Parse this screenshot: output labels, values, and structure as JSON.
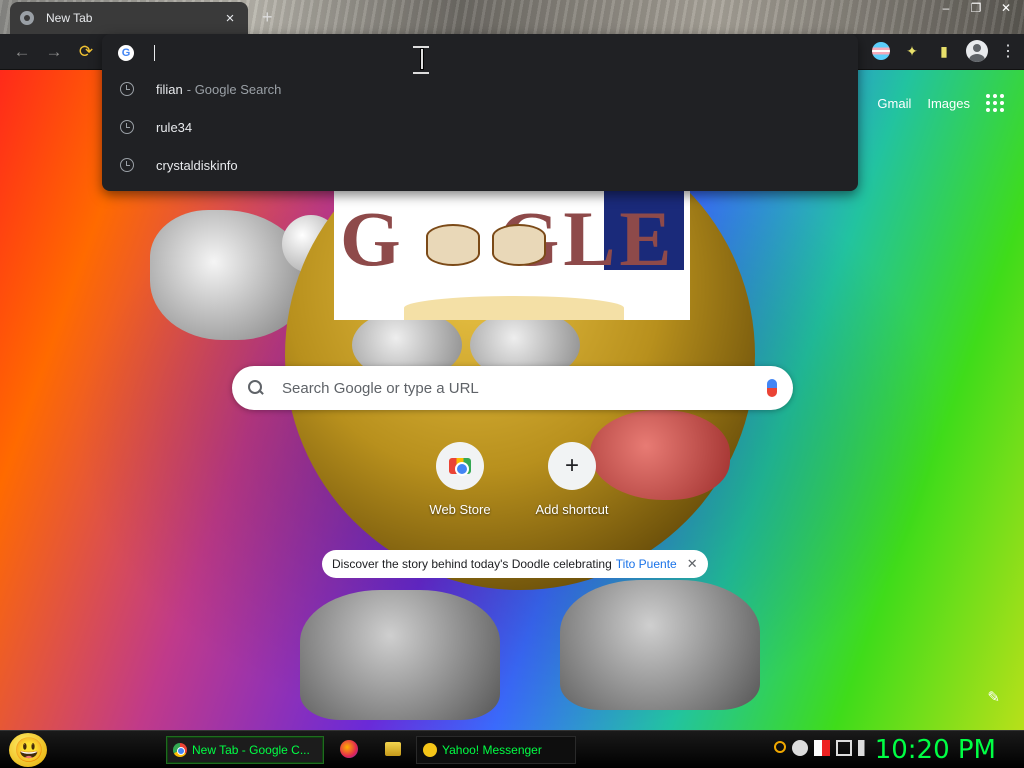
{
  "browser": {
    "tab_title": "New Tab",
    "tab_close": "×",
    "new_tab": "+",
    "window_controls": [
      "–",
      "❐",
      "✕"
    ]
  },
  "toolbar": {
    "back": "←",
    "forward": "→",
    "reload": "⟳",
    "menu": "⋮"
  },
  "omnibox": {
    "input_value": "",
    "suggestions": [
      {
        "text": "filian",
        "suffix": "- Google Search"
      },
      {
        "text": "rule34",
        "suffix": ""
      },
      {
        "text": "crystaldiskinfo",
        "suffix": ""
      }
    ]
  },
  "google_bar": {
    "gmail": "Gmail",
    "images": "Images"
  },
  "search": {
    "placeholder": "Search Google or type a URL"
  },
  "shortcuts": [
    {
      "label": "Web Store"
    },
    {
      "label": "Add shortcut",
      "glyph": "+"
    }
  ],
  "promo": {
    "text": "Discover the story behind today's Doodle celebrating",
    "link": "Tito Puente",
    "close": "✕"
  },
  "customize": {
    "glyph": "✎"
  },
  "taskbar": {
    "tasks": [
      {
        "label": "New Tab - Google C..."
      },
      {
        "label": "Yahoo! Messenger"
      }
    ],
    "clock": "10:20 PM"
  },
  "colors": {
    "taskbar_text": "#00ff44",
    "omnibox_bg": "#202124",
    "link_blue": "#1a73e8"
  }
}
